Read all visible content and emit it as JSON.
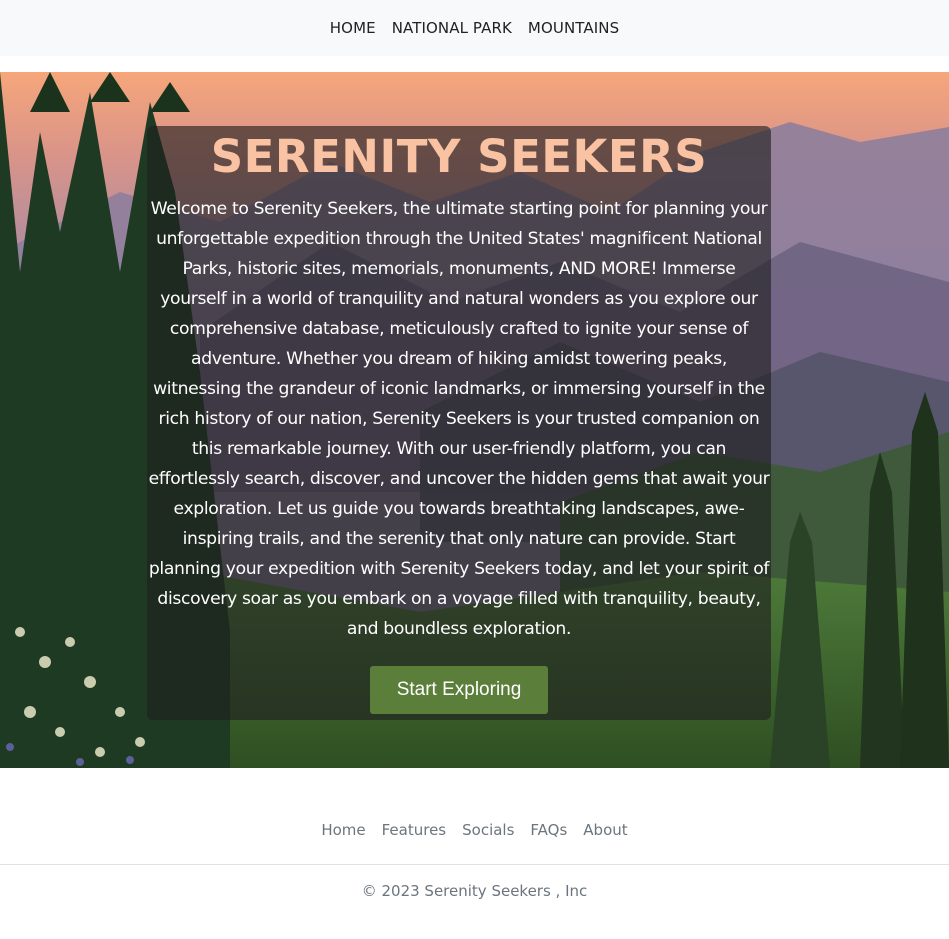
{
  "nav": {
    "items": [
      {
        "label": "HOME"
      },
      {
        "label": "NATIONAL PARK"
      },
      {
        "label": "MOUNTAINS"
      }
    ]
  },
  "hero": {
    "title": "SERENITY SEEKERS",
    "description": "Welcome to Serenity Seekers, the ultimate starting point for planning your unforgettable expedition through the United States' magnificent National Parks, historic sites, memorials, monuments, AND MORE! Immerse yourself in a world of tranquility and natural wonders as you explore our comprehensive database, meticulously crafted to ignite your sense of adventure. Whether you dream of hiking amidst towering peaks, witnessing the grandeur of iconic landmarks, or immersing yourself in the rich history of our nation, Serenity Seekers is your trusted companion on this remarkable journey. With our user-friendly platform, you can effortlessly search, discover, and uncover the hidden gems that await your exploration. Let us guide you towards breathtaking landscapes, awe-inspiring trails, and the serenity that only nature can provide. Start planning your expedition with Serenity Seekers today, and let your spirit of discovery soar as you embark on a voyage filled with tranquility, beauty, and boundless exploration.",
    "cta_label": "Start Exploring"
  },
  "footer": {
    "links": [
      {
        "label": "Home"
      },
      {
        "label": "Features"
      },
      {
        "label": "Socials"
      },
      {
        "label": "FAQs"
      },
      {
        "label": "About"
      }
    ],
    "copyright": "© 2023 Serenity Seekers , Inc"
  },
  "colors": {
    "title": "#f9c2a2",
    "cta_bg": "#5b7f3a",
    "nav_bg": "#f8f9fa",
    "footer_text": "#6c757d"
  }
}
